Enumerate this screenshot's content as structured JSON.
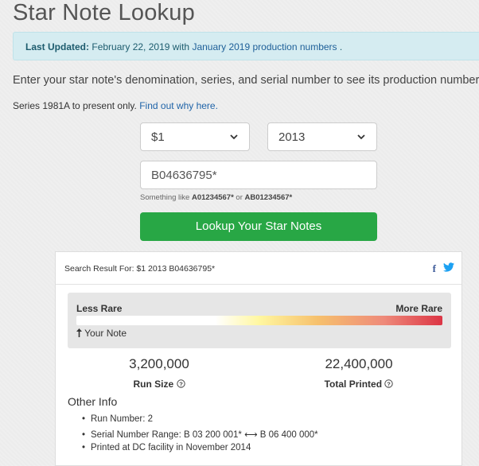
{
  "page": {
    "title": "Star Note Lookup"
  },
  "alert": {
    "label": "Last Updated:",
    "text": "February 22, 2019 with ",
    "link": "January 2019 production numbers",
    "suffix": " ."
  },
  "intro": "Enter your star note's denomination, series, and serial number to see its production numbers.",
  "note": {
    "text": "Series 1981A to present only. ",
    "link": "Find out why here."
  },
  "form": {
    "denomination": "$1",
    "series": "2013",
    "serial": "B04636795*",
    "hint_prefix": "Something like ",
    "hint_ex1": "A01234567*",
    "hint_mid": " or ",
    "hint_ex2": "AB01234567*",
    "button": "Lookup Your Star Notes"
  },
  "result": {
    "header": "Search Result For: $1 2013 B04636795*",
    "share_facebook": "f",
    "scale": {
      "less": "Less Rare",
      "more": "More Rare",
      "marker": "Your Note",
      "position": 0.0
    },
    "run_size": {
      "value": "3,200,000",
      "label": "Run Size"
    },
    "total_printed": {
      "value": "22,400,000",
      "label": "Total Printed"
    },
    "other_title": "Other Info",
    "info": [
      "Run Number: 2",
      "Serial Number Range: B 03 200 001* ⟷ B 06 400 000*",
      "Printed at DC facility in November 2014"
    ]
  },
  "colors": {
    "accent": "#28a745",
    "link": "#1e63a8",
    "alert_bg": "#d5ecf1",
    "rare_end": "#dc3545"
  },
  "icons": [
    "chevron-down-icon",
    "facebook-icon",
    "twitter-icon",
    "help-icon",
    "arrow-up-icon"
  ]
}
